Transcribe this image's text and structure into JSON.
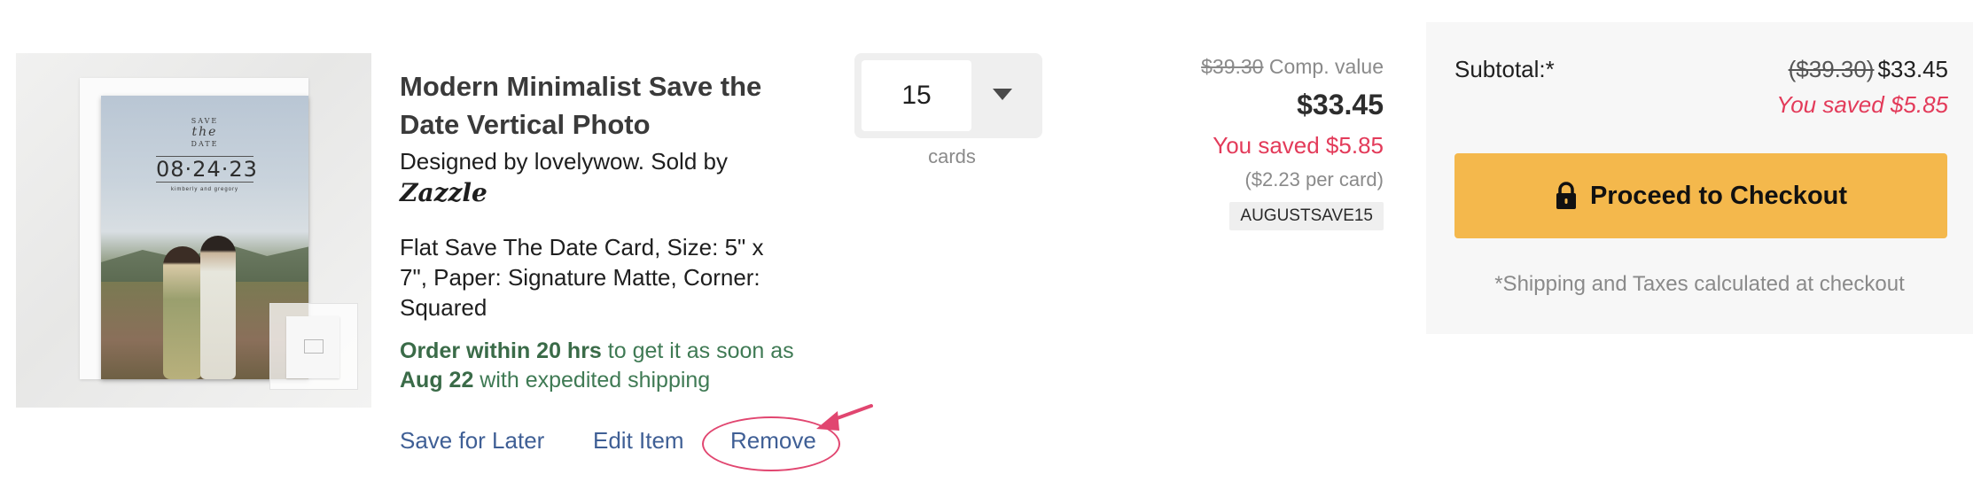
{
  "product": {
    "title": "Modern Minimalist Save the Date Vertical Photo",
    "designed_by": "Designed by lovelywow. Sold by",
    "seller": "Zazzle",
    "specs": "Flat Save The Date Card, Size: 5\" x 7\", Paper: Signature Matte, Corner: Squared",
    "image": {
      "save_line1": "SAVE",
      "save_line2": "the",
      "save_line3": "DATE",
      "date": "08·24·23",
      "names": "kimberly and gregory"
    }
  },
  "shipping_note": {
    "lead_bold": "Order within 20 hrs",
    "middle": " to get it as soon as ",
    "date_bold": "Aug 22",
    "tail": " with expedited shipping"
  },
  "actions": {
    "save_for_later": "Save for Later",
    "edit_item": "Edit Item",
    "remove": "Remove"
  },
  "quantity": {
    "value": "15",
    "unit": "cards"
  },
  "price": {
    "comp_value": "$39.30",
    "comp_label": " Comp. value",
    "current": "$33.45",
    "saved": "You saved $5.85",
    "per_card": "($2.23 per card)",
    "promo_code": "AUGUSTSAVE15"
  },
  "summary": {
    "subtotal_label": "Subtotal:*",
    "subtotal_original": "($39.30)",
    "subtotal_current": "$33.45",
    "saved": "You saved $5.85",
    "checkout_label": "Proceed to Checkout",
    "shipping_taxes": "*Shipping and Taxes calculated at checkout"
  },
  "colors": {
    "checkout_button": "#f4b84c",
    "saved_red": "#e33b5a",
    "link_blue": "#3f5f95",
    "shipping_green": "#3f7a54",
    "annotation": "#e14670"
  }
}
